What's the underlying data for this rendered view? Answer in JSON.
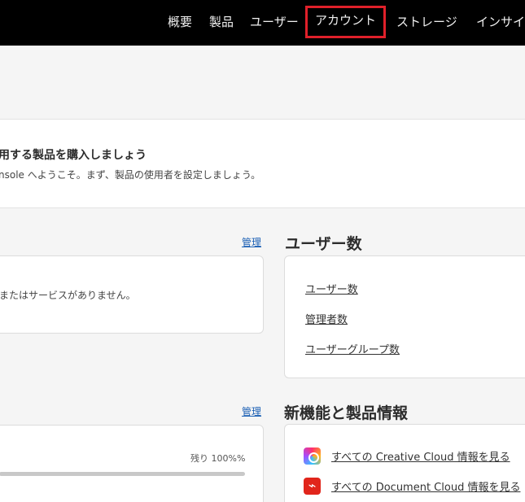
{
  "nav": {
    "items": [
      "概要",
      "製品",
      "ユーザー",
      "アカウント",
      "ストレージ",
      "インサイ"
    ],
    "active": "アカウント"
  },
  "banner": {
    "title": "用する製品を購入しましょう",
    "subtitle": "nsole へようこそ。まず、製品の使用者を設定しましょう。"
  },
  "products": {
    "manage_link": "管理",
    "empty_text": "またはサービスがありません。"
  },
  "users": {
    "title": "ユーザー数",
    "links": [
      "ユーザー数",
      "管理者数",
      "ユーザーグループ数"
    ]
  },
  "storage": {
    "manage_link": "管理",
    "remaining": "残り 100%%",
    "remaining_fraction": 1.0
  },
  "news": {
    "title": "新機能と製品情報",
    "items": [
      {
        "icon": "creative-cloud-icon",
        "label": "すべての Creative Cloud 情報を見る"
      },
      {
        "icon": "document-cloud-icon",
        "label": "すべての Document Cloud 情報を見る"
      }
    ]
  },
  "colors": {
    "nav_bg": "#000000",
    "highlight": "#e0202a",
    "link": "#1a5fb4"
  }
}
